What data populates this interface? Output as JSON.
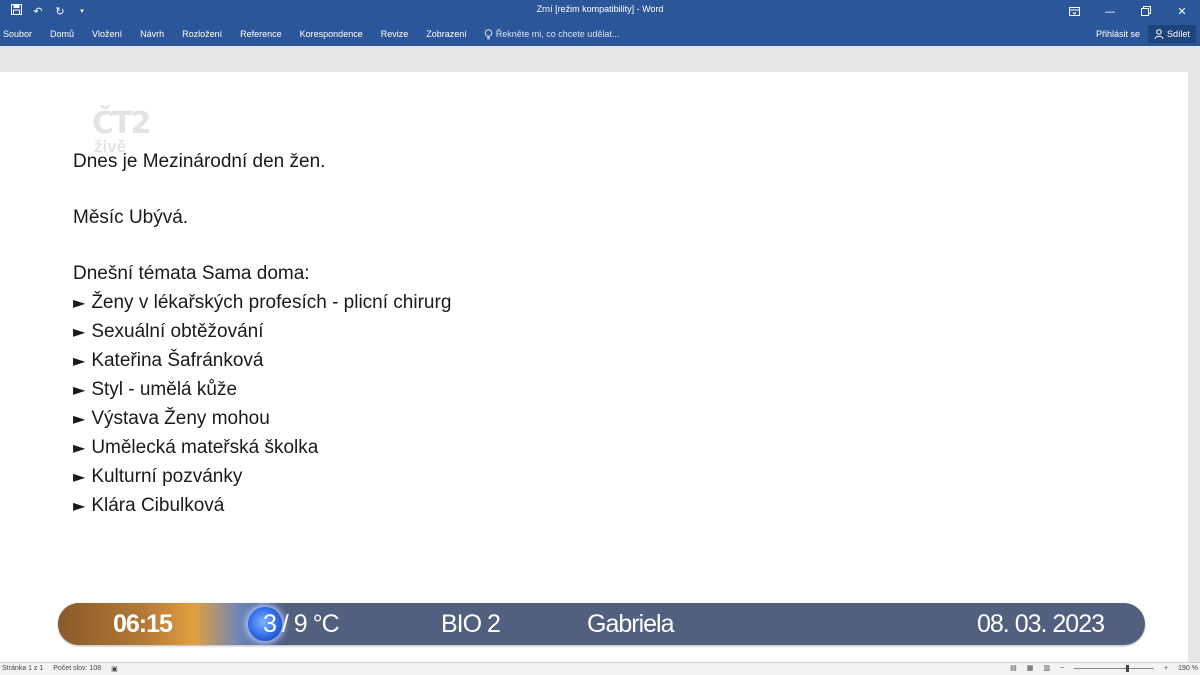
{
  "window": {
    "title": "Zrní [režim kompatibility] - Word"
  },
  "quick_access": {
    "icons": [
      "save-icon",
      "undo-icon",
      "redo-icon",
      "customize-icon"
    ]
  },
  "ribbon": {
    "tabs": [
      "Soubor",
      "Domů",
      "Vložení",
      "Návrh",
      "Rozložení",
      "Reference",
      "Korespondence",
      "Revize",
      "Zobrazení"
    ],
    "tell_me": "Řekněte mi, co chcete udělat...",
    "sign_in": "Přihlásit se",
    "share": "Sdílet"
  },
  "watermark": {
    "logo": "ČT2",
    "subtitle": "živě"
  },
  "document": {
    "line1": "Dnes je Mezinárodní den žen.",
    "line2": "Měsíc Ubývá.",
    "topics_heading": "Dnešní témata Sama doma:",
    "bullet_symbol": "►",
    "topics": [
      "Ženy v lékařských profesích - plicní chirurg",
      "Sexuální obtěžování",
      "Kateřina Šafránková",
      "Styl - umělá kůže",
      "Výstava Ženy mohou",
      "Umělecká mateřská školka",
      "Kulturní pozvánky",
      "Klára Cibulková"
    ]
  },
  "statusbar": {
    "page": "Stránka 1 z 1",
    "words": "Počet slov: 108",
    "zoom": "190 %"
  },
  "ticker": {
    "time": "06:15",
    "temperature": "3 / 9 °C",
    "channel": "BIO 2",
    "nameday": "Gabriela",
    "date": "08. 03. 2023"
  }
}
